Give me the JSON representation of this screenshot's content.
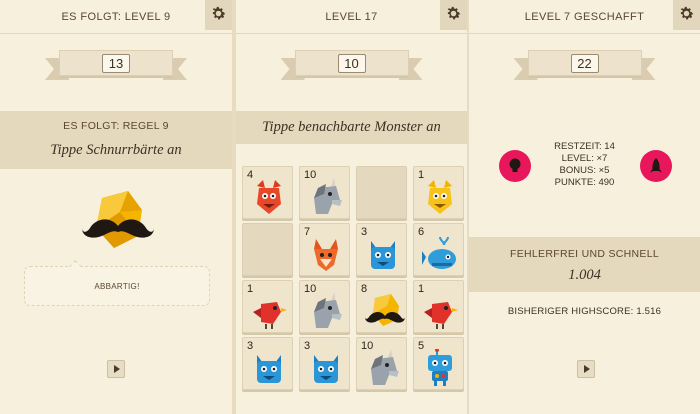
{
  "panels": [
    {
      "header": "ES FOLGT: LEVEL 9",
      "ribbon_number": "13",
      "banner_sub": "ES FOLGT: REGEL 9",
      "banner_rule": "Tippe Schnurrbärte an",
      "message": "ABBARTIG!"
    },
    {
      "header": "LEVEL 17",
      "ribbon_number": "10",
      "banner_rule": "Tippe benachbarte Monster an",
      "tiles": [
        {
          "num": "4",
          "monster": "devil"
        },
        {
          "num": "10",
          "monster": "unicorn"
        },
        {
          "num": "",
          "monster": "empty"
        },
        {
          "num": "1",
          "monster": "yellow-devil"
        },
        {
          "num": "",
          "monster": "empty"
        },
        {
          "num": "7",
          "monster": "fox"
        },
        {
          "num": "3",
          "monster": "blue-cat"
        },
        {
          "num": "6",
          "monster": "whale"
        },
        {
          "num": "1",
          "monster": "bird"
        },
        {
          "num": "10",
          "monster": "unicorn"
        },
        {
          "num": "8",
          "monster": "mustache-gem"
        },
        {
          "num": "1",
          "monster": "bird"
        },
        {
          "num": "3",
          "monster": "blue-cat"
        },
        {
          "num": "3",
          "monster": "blue-cat"
        },
        {
          "num": "10",
          "monster": "unicorn"
        },
        {
          "num": "5",
          "monster": "robot"
        }
      ]
    },
    {
      "header": "LEVEL 7 GESCHAFFT",
      "ribbon_number": "22",
      "stats": [
        "RESTZEIT: 14",
        "LEVEL: ×7",
        "BONUS: ×5",
        "PUNKTE: 490"
      ],
      "banner_sub": "FEHLERFREI UND SCHNELL",
      "banner_score": "1.004",
      "highscore": "BISHERIGER HIGHSCORE: 1.516"
    }
  ],
  "colors": {
    "background": "#f7f0dd",
    "banner": "#e5d9bd",
    "accent_medal": "#e8175c",
    "text": "#3e3024"
  },
  "icons": [
    "gear-icon",
    "play-icon",
    "lightbulb-icon",
    "rocket-icon",
    "mustache-gem-icon"
  ]
}
